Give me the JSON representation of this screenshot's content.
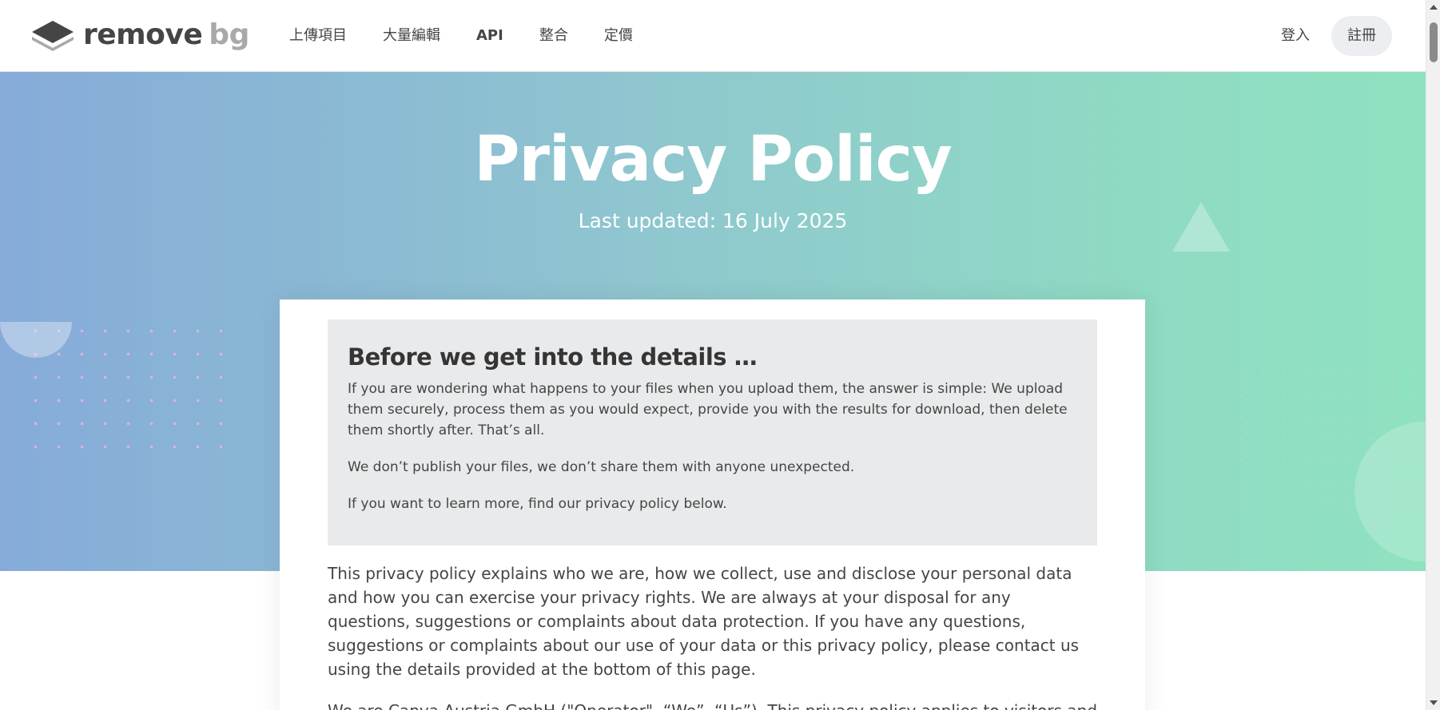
{
  "header": {
    "logo": {
      "word_remove": "remove",
      "word_bg": "bg"
    },
    "nav": [
      {
        "label": "上傳項目"
      },
      {
        "label": "大量編輯"
      },
      {
        "label": "API"
      },
      {
        "label": "整合"
      },
      {
        "label": "定價"
      }
    ],
    "login_label": "登入",
    "signup_label": "註冊"
  },
  "hero": {
    "title": "Privacy Policy",
    "subtitle": "Last updated: 16 July 2025"
  },
  "summary": {
    "title": "Before we get into the details …",
    "paragraphs": [
      "If you are wondering what happens to your files when you upload them, the answer is simple: We upload them securely, process them as you would expect, provide you with the results for download, then delete them shortly after. That’s all.",
      "We don’t publish your files, we don’t share them with anyone unexpected.",
      "If you want to learn more, find our privacy policy below."
    ]
  },
  "body": {
    "intro": "This privacy policy explains who we are, how we collect, use and disclose your personal data and how you can exercise your privacy rights. We are always at your disposal for any questions, suggestions or complaints about data protection. If you have any questions, suggestions or complaints about our use of your data or this privacy policy, please contact us using the details provided at the bottom of this page.",
    "second": "We are Canva Austria GmbH (\"Operator\", “We”, “Us”). This privacy policy applies to visitors and users"
  },
  "colors": {
    "hero_gradient_start": "#86abd9",
    "hero_gradient_end": "#8fe2bf",
    "summary_bg": "#e9eaeb",
    "text": "#454545"
  },
  "icons": [
    "logo-layers-icon",
    "scroll-up-arrow-icon",
    "scroll-down-arrow-icon"
  ]
}
